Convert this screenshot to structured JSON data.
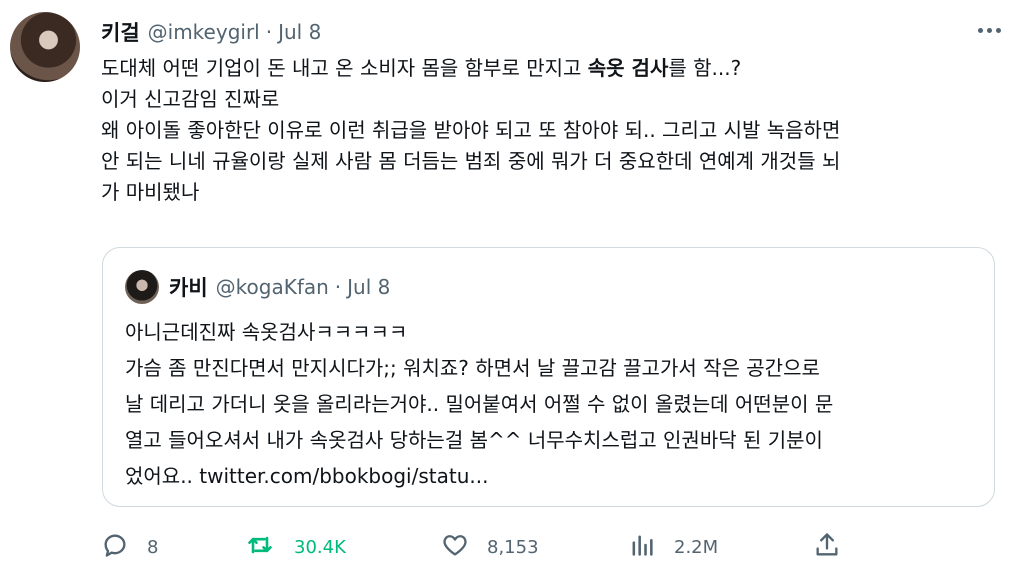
{
  "tweet": {
    "display_name": "키걸",
    "handle": "@imkeygirl",
    "separator": "·",
    "date": "Jul 8",
    "lines": [
      {
        "before": "도대체 어떤 기업이 돈 내고 온 소비자 몸을 함부로 만지고 ",
        "bold": "속옷 검사",
        "after": "를 함...?"
      },
      {
        "text": "이거 신고감임 진짜로"
      },
      {
        "text": "왜 아이돌 좋아한단 이유로 이런 취급을 받아야 되고 또 참아야 되.. 그리고 시발 녹음하면"
      },
      {
        "text": "안 되는 니네 규율이랑 실제 사람 몸 더듬는 범죄 중에 뭐가 더 중요한데 연예계 개것들 뇌"
      },
      {
        "text": "가 마비됐나"
      }
    ]
  },
  "quote": {
    "display_name": "카비",
    "handle": "@kogaKfan",
    "separator": "·",
    "date": "Jul 8",
    "lines": [
      "아니근데진짜 속옷검사ㅋㅋㅋㅋㅋ",
      "가슴 좀 만진다면서 만지시다가;; 워치죠? 하면서 날 끌고감 끌고가서 작은 공간으로",
      "날 데리고 가더니 옷을 올리라는거야.. 밀어붙여서 어쩔 수 없이 올렸는데 어떤분이 문",
      "열고 들어오셔서 내가 속옷검사 당하는걸 봄^^ 너무수치스럽고 인권바닥 된 기분이",
      "었어요.. twitter.com/bbokbogi/statu..."
    ]
  },
  "actions": {
    "reply_count": "8",
    "retweet_count": "30.4K",
    "like_count": "8,153",
    "view_count": "2.2M"
  },
  "icons": {
    "more": "more-icon",
    "reply": "reply-icon",
    "retweet": "retweet-icon",
    "like": "heart-icon",
    "views": "views-icon",
    "share": "share-icon"
  },
  "colors": {
    "text": "#0f1419",
    "muted": "#536471",
    "retweet_active": "#00ba7c",
    "border": "#cfd9de"
  }
}
